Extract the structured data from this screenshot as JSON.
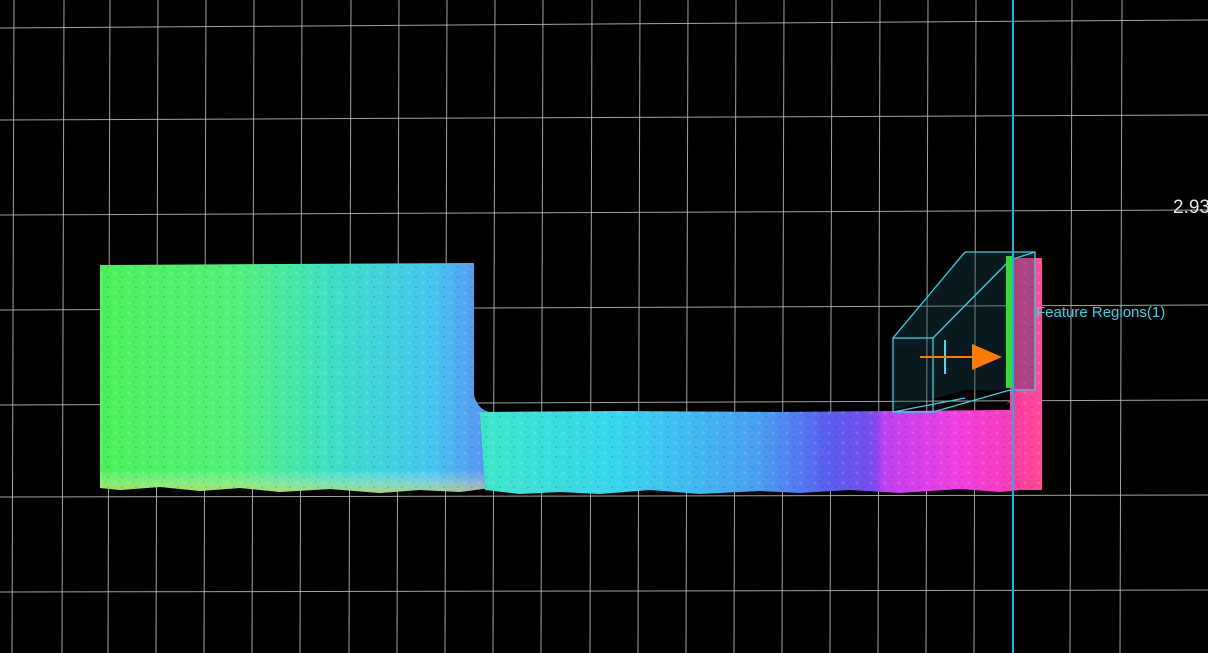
{
  "viewport": {
    "scale_value": "2.93",
    "feature_region_label": "Feature Regions(1)"
  },
  "colors": {
    "background": "#000000",
    "grid": "#bdbdbd",
    "measure_line": "#1fb0e8",
    "region_box": "#34d3e0",
    "arrow": "#ff7a00",
    "edge_marker": "#33dd33"
  },
  "icons": {
    "move_handle": "crosshair-icon",
    "direction_handle": "arrow-right-icon"
  }
}
